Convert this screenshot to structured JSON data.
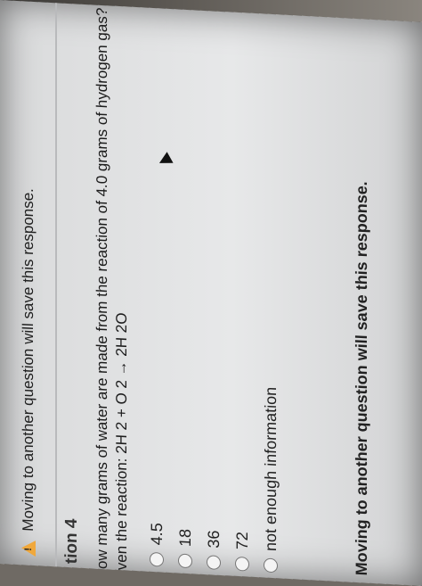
{
  "warning": {
    "icon": "warning-icon",
    "text": "Moving to another question will save this response."
  },
  "question": {
    "label": "tion 4",
    "line1": "ow many grams of water are made from the reaction of 4.0 grams of hydrogen gas?",
    "line2": "ven the reaction: 2H 2 + O 2 → 2H 2O"
  },
  "choices": [
    {
      "label": "4.5"
    },
    {
      "label": "18"
    },
    {
      "label": "36"
    },
    {
      "label": "72"
    },
    {
      "label": "not enough information"
    }
  ],
  "footer": {
    "text": "Moving to another question will save this response."
  },
  "colors": {
    "warning": "#f0a83c"
  }
}
